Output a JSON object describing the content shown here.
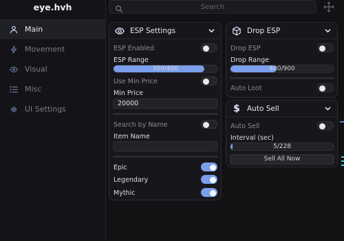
{
  "app": {
    "title": "eye.hvh"
  },
  "search": {
    "placeholder": "Search"
  },
  "sidebar": {
    "items": [
      {
        "label": "Main",
        "icon": "user-icon",
        "active": true
      },
      {
        "label": "Movement",
        "icon": "bolt-icon",
        "active": false
      },
      {
        "label": "Visual",
        "icon": "eye-icon",
        "active": false
      },
      {
        "label": "Misc",
        "icon": "list-icon",
        "active": false
      },
      {
        "label": "UI Settings",
        "icon": "gear-icon",
        "active": false
      }
    ]
  },
  "esp": {
    "title": "ESP Settings",
    "esp_enabled": {
      "label": "ESP Enabled",
      "on": false
    },
    "esp_range": {
      "label": "ESP Range",
      "value": "350/400",
      "fraction": 0.875
    },
    "use_min_price": {
      "label": "Use Min Price",
      "on": false
    },
    "min_price": {
      "label": "Min Price",
      "value": "20000"
    },
    "search_by_name": {
      "label": "Search by Name",
      "on": false
    },
    "item_name": {
      "label": "Item Name",
      "value": ""
    },
    "epic": {
      "label": "Epic",
      "on": true
    },
    "legendary": {
      "label": "Legendary",
      "on": true
    },
    "mythic": {
      "label": "Mythic",
      "on": true
    }
  },
  "drop": {
    "title": "Drop ESP",
    "drop_esp": {
      "label": "Drop ESP",
      "on": false
    },
    "drop_range": {
      "label": "Drop Range",
      "value": "400/900",
      "fraction": 0.444
    },
    "auto_loot": {
      "label": "Auto Loot",
      "on": false
    }
  },
  "autosell": {
    "title": "Auto Sell",
    "auto_sell": {
      "label": "Auto Sell",
      "on": false
    },
    "interval": {
      "label": "Interval (sec)",
      "value": "5/228",
      "fraction": 0.02
    },
    "sell_all": {
      "label": "Sell All Now"
    }
  },
  "colors": {
    "accent": "#7a9eea",
    "bg": "#121215",
    "panel": "#17171b"
  }
}
